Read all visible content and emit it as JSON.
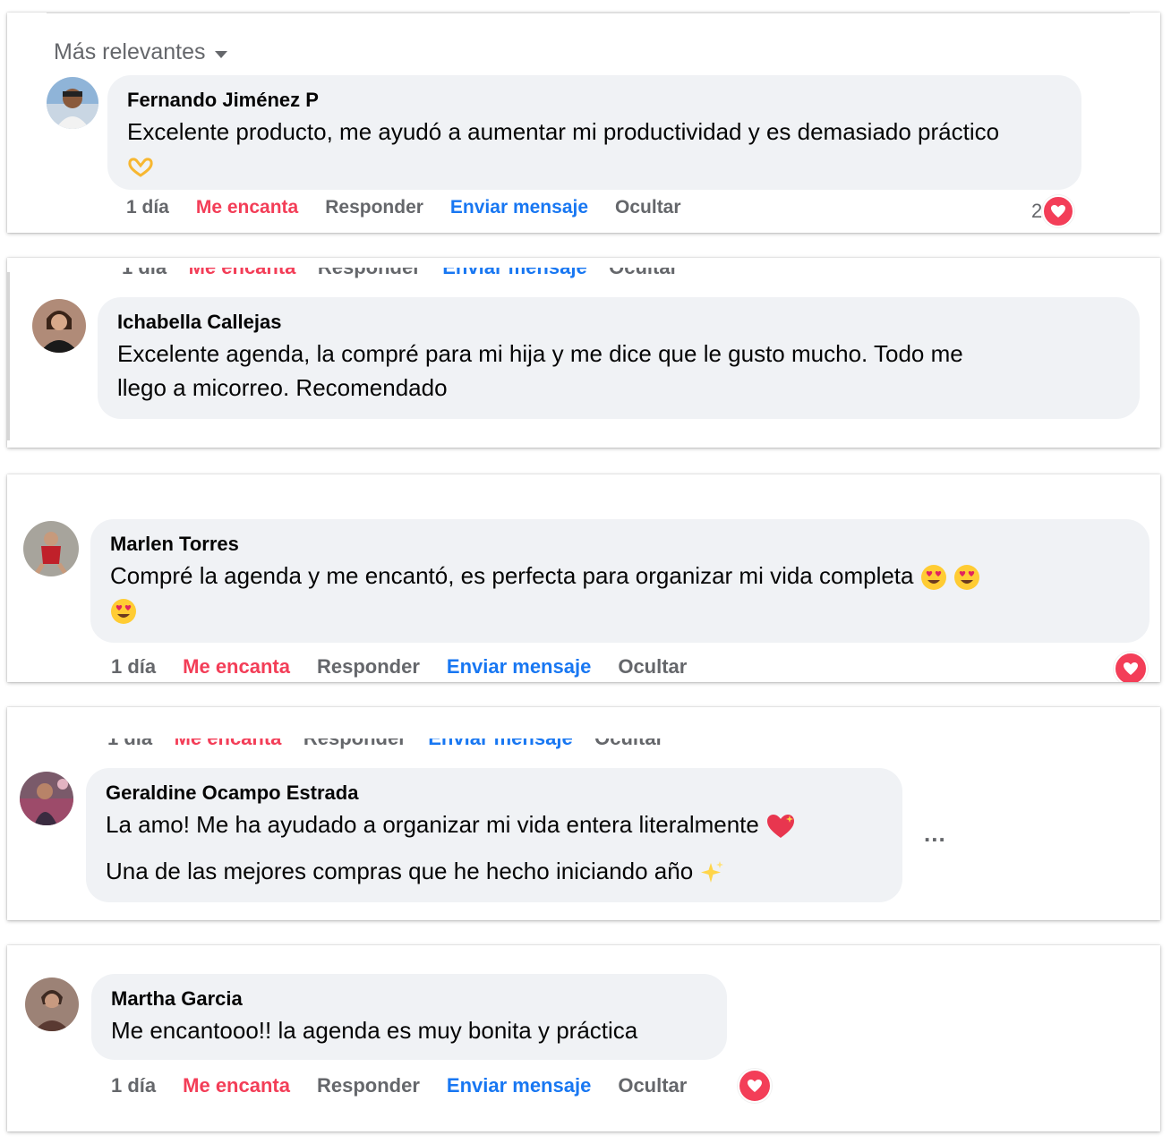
{
  "sort": {
    "label": "Más relevantes"
  },
  "comments": [
    {
      "author": "Fernando Jiménez P",
      "text": "Excelente producto, me ayudó a aumentar mi productividad y es demasiado práctico",
      "emojis": [
        "heart-hands"
      ],
      "time": "1 día",
      "love": "Me encanta",
      "reply": "Responder",
      "message": "Enviar mensaje",
      "hide": "Ocultar",
      "reaction_count": "2",
      "reaction": "love"
    },
    {
      "author": "Ichabella Callejas",
      "text_line1": "Excelente agenda, la compré para mi hija y me dice que le gusto mucho. Todo me",
      "text_line2": "llego a micorreo. Recomendado"
    },
    {
      "author": "Marlen Torres",
      "text": "Compré la agenda y me encantó, es perfecta para organizar mi vida completa",
      "emojis": [
        "heart-eyes",
        "heart-eyes",
        "heart-eyes"
      ],
      "time": "1 día",
      "love": "Me encanta",
      "reply": "Responder",
      "message": "Enviar mensaje",
      "hide": "Ocultar",
      "reaction": "love"
    },
    {
      "author": "Geraldine Ocampo Estrada",
      "text_line1": "La amo! Me ha ayudado a organizar mi vida entera literalmente",
      "text_line2": "Una de las mejores compras que he hecho iniciando año",
      "emojis": [
        "sparkling-heart",
        "sparkles"
      ],
      "more": "..."
    },
    {
      "author": "Martha Garcia",
      "text": "Me encantooo!! la agenda es muy bonita y práctica",
      "time": "1 día",
      "love": "Me encanta",
      "reply": "Responder",
      "message": "Enviar mensaje",
      "hide": "Ocultar",
      "reaction": "love"
    }
  ],
  "colors": {
    "love": "#f33e58",
    "link": "#1877f2",
    "muted": "#65676b",
    "bubble": "#f0f2f5"
  }
}
